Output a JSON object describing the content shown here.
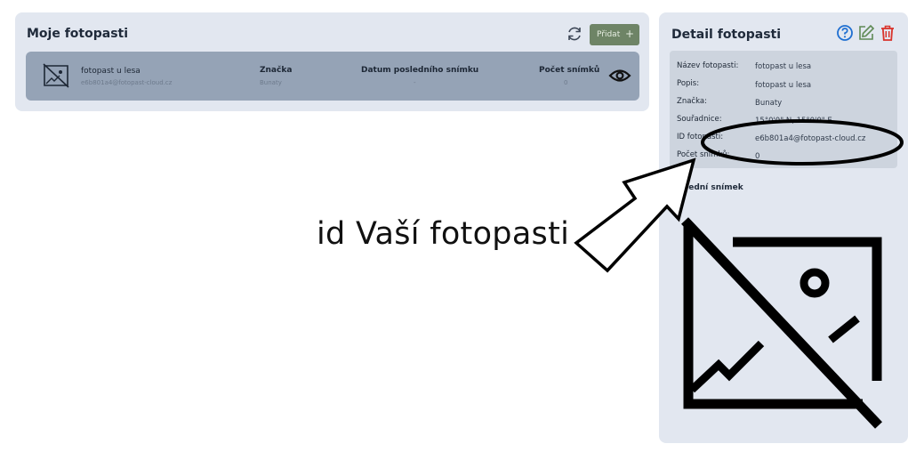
{
  "left_panel": {
    "title": "Moje fotopasti",
    "refresh_icon": "refresh-icon",
    "add_label": "Přidat",
    "add_icon": "+"
  },
  "trap_row": {
    "name": "fotopast u lesa",
    "email": "e6b801a4@fotopast-cloud.cz",
    "brand_header": "Značka",
    "brand_value": "Bunaty",
    "last_photo_header": "Datum posledního snímku",
    "last_photo_value": "-",
    "count_header": "Počet snímků",
    "count_value": "0",
    "view_icon": "eye-icon"
  },
  "detail": {
    "title": "Detail fotopasti",
    "icons": [
      "help-icon",
      "edit-icon",
      "delete-icon"
    ],
    "fields": [
      {
        "label": "Název fotopasti:",
        "value": "fotopast u lesa"
      },
      {
        "label": "Popis:",
        "value": "fotopast u lesa"
      },
      {
        "label": "Značka:",
        "value": "Bunaty"
      },
      {
        "label": "Souřadnice:",
        "value": "15°0'0\" N, 15°0'0\" E"
      },
      {
        "label": "ID fotopasti:",
        "value": "e6b801a4@fotopast-cloud.cz"
      },
      {
        "label": "Počet snímků:",
        "value": "0"
      }
    ],
    "last_photo_title": "Poslední snímek"
  },
  "annotation": {
    "caption": "id Vaší fotopasti"
  },
  "colors": {
    "panel_bg": "#e2e7f0",
    "row_bg": "#95a3b6",
    "add_button": "#6e8466",
    "delete_red": "#d9332b",
    "help_blue": "#1f6fd1"
  }
}
